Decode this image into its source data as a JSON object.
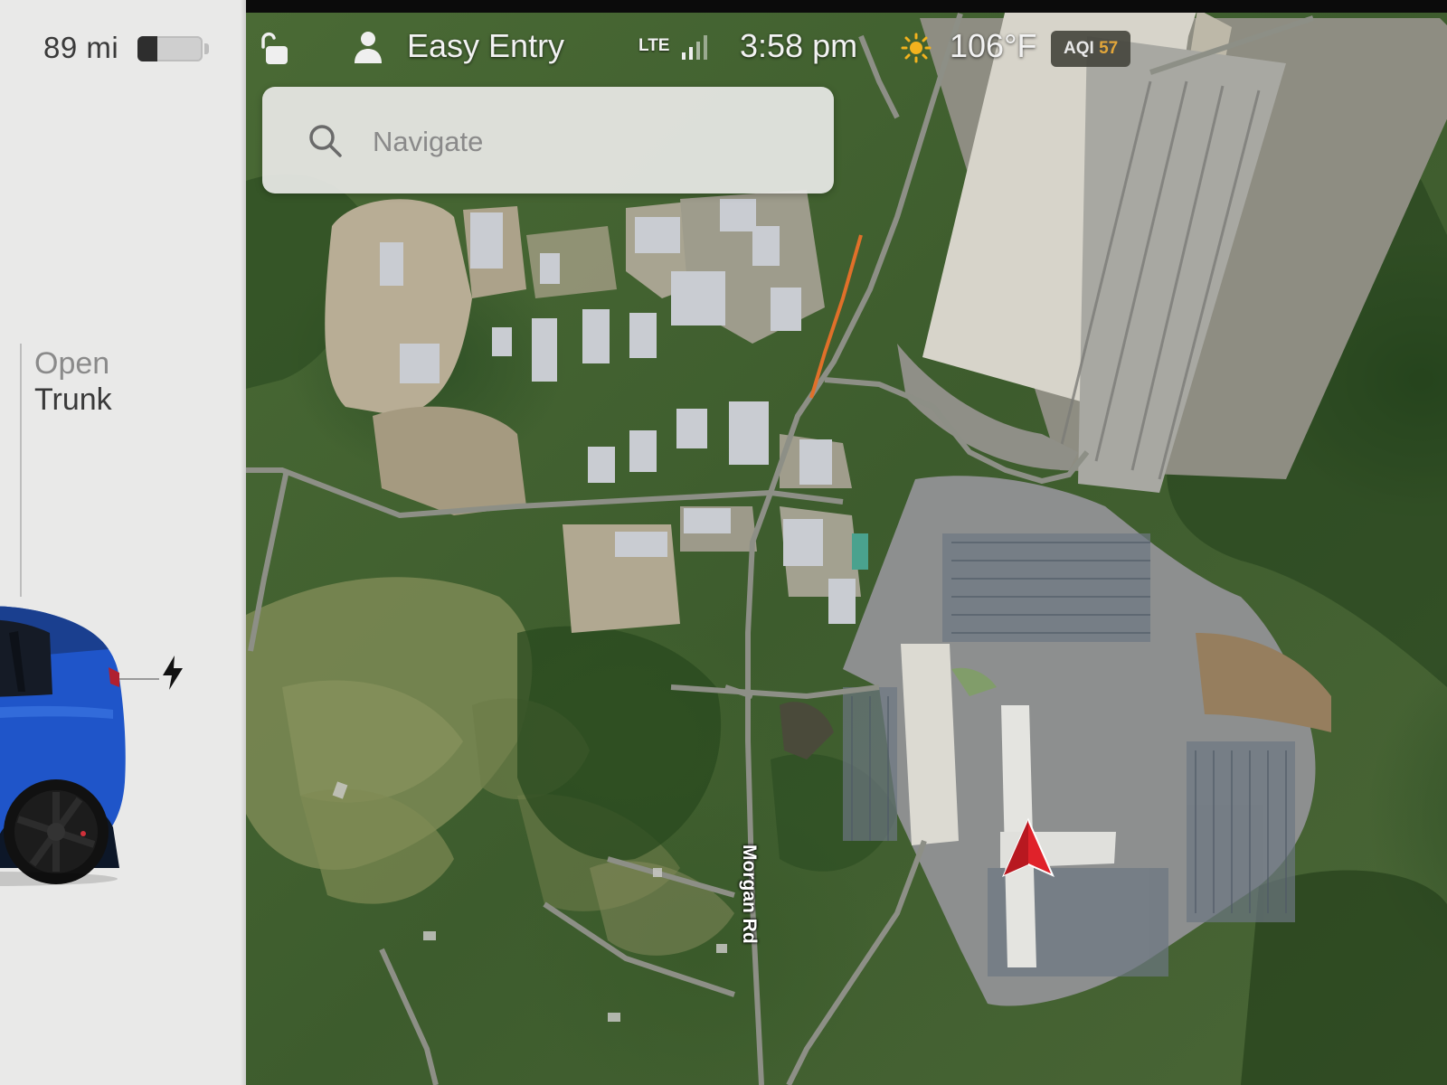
{
  "car_panel": {
    "range": "89 mi",
    "battery_level": 0.3,
    "trunk_action": {
      "line1": "Open",
      "line2": "Trunk"
    },
    "charge_port_icon": "lightning-bolt-icon",
    "car_color": "#1f55c9"
  },
  "status_bar": {
    "lock_icon": "unlocked-padlock-icon",
    "profile_icon": "person-icon",
    "profile_name": "Easy Entry",
    "network": "LTE",
    "time": "3:58 pm",
    "weather_icon": "sun-icon",
    "temperature": "106°F",
    "aqi_label": "AQI",
    "aqi_value": "57",
    "aqi_color": "#e2a63a"
  },
  "search": {
    "placeholder": "Navigate",
    "icon": "magnifier-icon"
  },
  "map": {
    "mode": "satellite",
    "road_label": "Morgan Rd",
    "position_marker_color": "#e0222a",
    "traffic_color": "#e0702a"
  }
}
